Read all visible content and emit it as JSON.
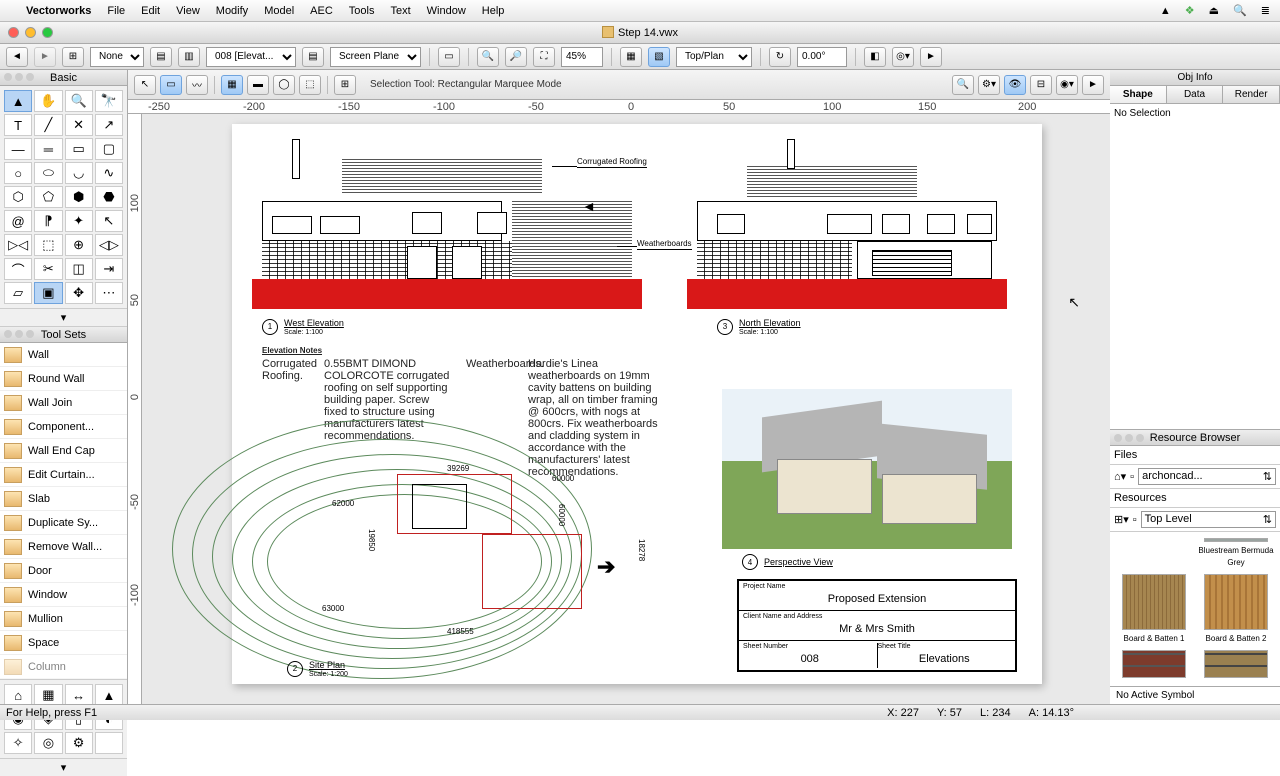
{
  "menubar": {
    "app": "Vectorworks",
    "items": [
      "File",
      "Edit",
      "View",
      "Modify",
      "Model",
      "AEC",
      "Tools",
      "Text",
      "Window",
      "Help"
    ]
  },
  "window": {
    "title": "Step 14.vwx"
  },
  "toolbar": {
    "class_dd": "None",
    "layer_dd": "008 [Elevat...",
    "plane_dd": "Screen Plane",
    "zoom": "45%",
    "view_dd": "Top/Plan",
    "angle": "0.00°"
  },
  "modebar": {
    "hint": "Selection Tool: Rectangular Marquee Mode"
  },
  "basic_palette": {
    "title": "Basic"
  },
  "toolsets": {
    "title": "Tool Sets",
    "items": [
      "Wall",
      "Round Wall",
      "Wall Join",
      "Component...",
      "Wall End Cap",
      "Edit Curtain...",
      "Slab",
      "Duplicate Sy...",
      "Remove Wall...",
      "Door",
      "Window",
      "Mullion",
      "Space",
      "Column"
    ]
  },
  "obj_info": {
    "title": "Obj Info",
    "tabs": [
      "Shape",
      "Data",
      "Render"
    ],
    "body": "No Selection"
  },
  "resource_browser": {
    "title": "Resource Browser",
    "files_label": "Files",
    "files_dd": "archoncad...",
    "resources_label": "Resources",
    "resources_dd": "Top Level",
    "thumbs": [
      "Bluestream Bermuda Grey",
      "Board & Batten 1",
      "Board & Batten 2",
      "",
      ""
    ],
    "footer": "No Active Symbol"
  },
  "sheet": {
    "callout1": "Corrugated Roofing",
    "callout2": "Weatherboards",
    "view1": {
      "num": "1",
      "title": "West Elevation",
      "scale": "Scale: 1:100"
    },
    "view2": {
      "num": "2",
      "title": "Site Plan",
      "scale": "Scale: 1:200"
    },
    "view3": {
      "num": "3",
      "title": "North Elevation",
      "scale": "Scale: 1:100"
    },
    "view4": {
      "num": "4",
      "title": "Perspective View",
      "scale": ""
    },
    "notes": {
      "heading": "Elevation Notes",
      "c1h": "Corrugated Roofing.",
      "c1": "0.55BMT DIMOND COLORCOTE corrugated roofing on self supporting building paper. Screw fixed to structure using manufacturers latest recommendations.",
      "c2h": "Weatherboards.",
      "c2": "Hardie's Linea weatherboards on 19mm cavity battens on building wrap, all on timber framing @ 600crs, with nogs at 800crs. Fix weatherboards and cladding system in accordance with the manufacturers' latest recommendations."
    },
    "dims": {
      "d1": "39269",
      "d2": "60000",
      "d3": "19850",
      "d4": "62000",
      "d5": "63000",
      "d6": "60000",
      "d7": "18278",
      "d8": "418555"
    },
    "titleblock": {
      "pn_lab": "Project Name",
      "pn": "Proposed Extension",
      "cn_lab": "Client Name and Address",
      "cn": "Mr & Mrs Smith",
      "sn_lab": "Sheet Number",
      "sn": "008",
      "st_lab": "Sheet Title",
      "st": "Elevations"
    }
  },
  "status": {
    "help": "For Help, press F1",
    "x": "X: 227",
    "y": "Y: 57",
    "l": "L: 234",
    "a": "A: 14.13°"
  },
  "ruler_h": [
    "-250",
    "-200",
    "-150",
    "-100",
    "-50",
    "0",
    "50",
    "100",
    "150",
    "200"
  ],
  "ruler_v": [
    "100",
    "50",
    "0",
    "-50",
    "-100"
  ]
}
